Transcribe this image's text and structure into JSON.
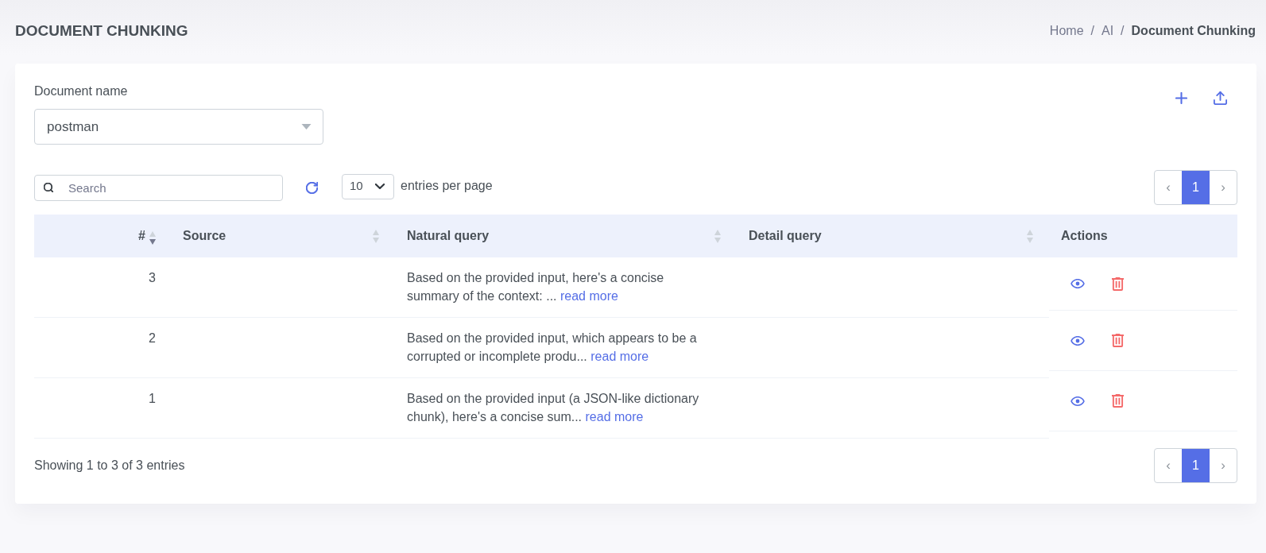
{
  "page_title": "DOCUMENT CHUNKING",
  "breadcrumb": [
    {
      "label": "Home",
      "current": false,
      "separator": "/"
    },
    {
      "label": "AI",
      "current": false,
      "separator": "/"
    },
    {
      "label": "Document Chunking",
      "current": true
    }
  ],
  "document_field": {
    "label": "Document name",
    "value": "postman"
  },
  "search": {
    "placeholder": "Search"
  },
  "page_size": {
    "value": "10",
    "label": "entries per page"
  },
  "pagination_top": {
    "prev": {
      "label": "‹",
      "disabled": true
    },
    "pages": [
      {
        "label": "1",
        "selected": true
      }
    ],
    "next": {
      "label": "›",
      "disabled": true
    }
  },
  "table": {
    "columns": [
      {
        "label": "#",
        "sorted": true
      },
      {
        "label": "Source",
        "sorted": false
      },
      {
        "label": "Natural query",
        "sorted": false
      },
      {
        "label": "Detail query",
        "sorted": false
      },
      {
        "label": "Actions"
      }
    ],
    "rows": [
      {
        "number": "3",
        "natural_query": "Based on the provided input, here's a concise summary of the context: ...",
        "link": "read more"
      },
      {
        "number": "2",
        "natural_query": "Based on the provided input, which appears to be a corrupted or incomplete produ...",
        "link": "read more"
      },
      {
        "number": "1",
        "natural_query": "Based on the provided input (a JSON-like dictionary chunk), here's a concise sum...",
        "link": "read more"
      }
    ]
  },
  "footer": {
    "info": "Showing 1 to 3 of 3 entries",
    "pagination": {
      "prev": {
        "label": "‹",
        "disabled": true
      },
      "pages": [
        {
          "label": "1",
          "selected": true
        }
      ],
      "next": {
        "label": "›",
        "disabled": true
      }
    }
  }
}
